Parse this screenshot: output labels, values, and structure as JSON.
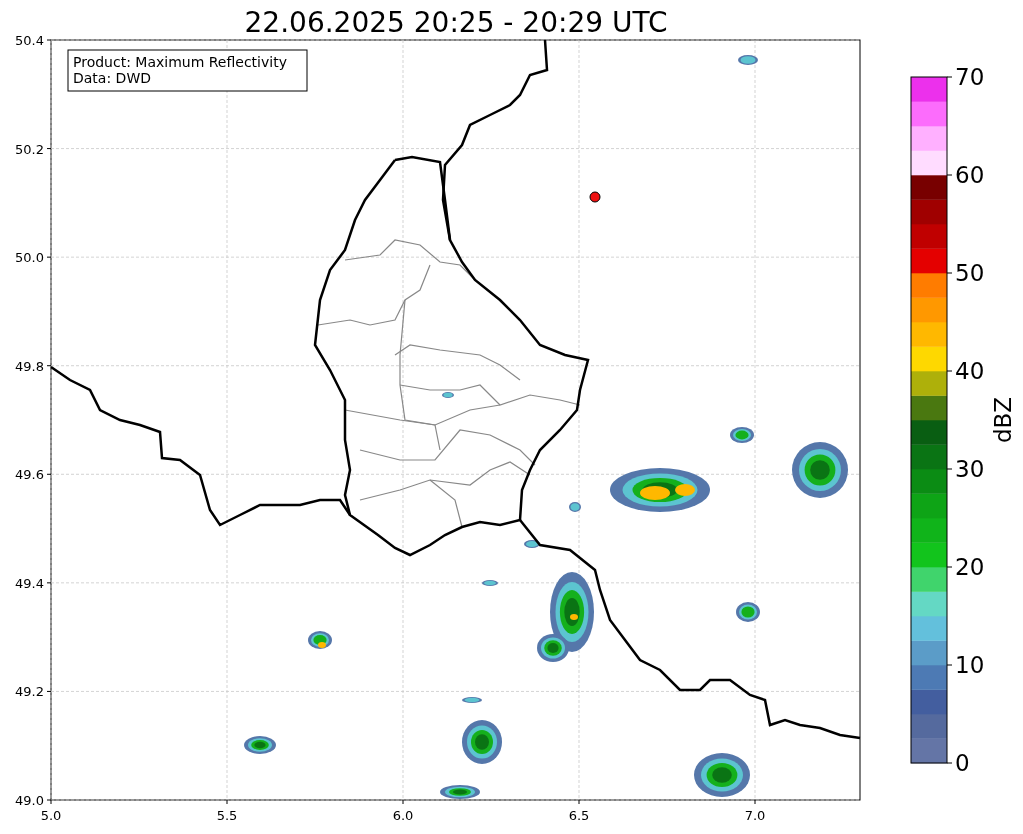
{
  "title": "22.06.2025 20:25 - 20:29 UTC",
  "info_box": [
    "Product: Maximum Reflectivity",
    "Data: DWD"
  ],
  "x_ticks": [
    "5.0",
    "5.5",
    "6.0",
    "6.5",
    "7.0"
  ],
  "y_ticks": [
    "50.4",
    "50.2",
    "50.0",
    "49.8",
    "49.6",
    "49.4",
    "49.2",
    "49.0"
  ],
  "colorbar": {
    "label": "dBZ",
    "ticks": [
      "70",
      "60",
      "50",
      "40",
      "30",
      "20",
      "10",
      "0"
    ],
    "bands": [
      {
        "color": "#6475a6"
      },
      {
        "color": "#556a9e"
      },
      {
        "color": "#435e9f"
      },
      {
        "color": "#4d7ab4"
      },
      {
        "color": "#5b9cc8"
      },
      {
        "color": "#63c0dc"
      },
      {
        "color": "#64d8c4"
      },
      {
        "color": "#40d46c"
      },
      {
        "color": "#12c41c"
      },
      {
        "color": "#10b41a"
      },
      {
        "color": "#0ea416"
      },
      {
        "color": "#0b8c14"
      },
      {
        "color": "#0a7414"
      },
      {
        "color": "#095e12"
      },
      {
        "color": "#4a7810"
      },
      {
        "color": "#aeb00a"
      },
      {
        "color": "#fed800"
      },
      {
        "color": "#ffb800"
      },
      {
        "color": "#ff9800"
      },
      {
        "color": "#ff7c00"
      },
      {
        "color": "#e40000"
      },
      {
        "color": "#c00000"
      },
      {
        "color": "#a00000"
      },
      {
        "color": "#780000"
      },
      {
        "color": "#ffdcff"
      },
      {
        "color": "#ffb0ff"
      },
      {
        "color": "#fc6cfc"
      },
      {
        "color": "#ec30ec"
      }
    ]
  }
}
